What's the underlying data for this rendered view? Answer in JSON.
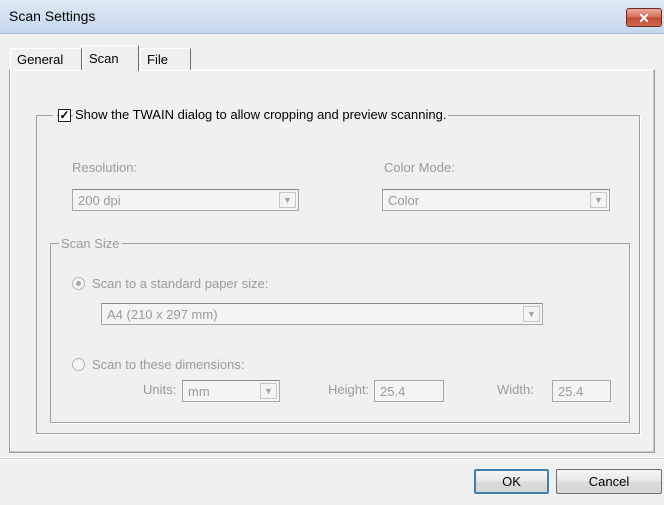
{
  "window": {
    "title": "Scan Settings",
    "close_glyph": "✕"
  },
  "tabs": [
    {
      "label": "General"
    },
    {
      "label": "Scan"
    },
    {
      "label": "File"
    }
  ],
  "twain": {
    "label": "Show the TWAIN dialog to allow cropping and preview scanning.",
    "checked": true,
    "check_glyph": "✓"
  },
  "resolution": {
    "label": "Resolution:",
    "value": "200 dpi"
  },
  "color_mode": {
    "label": "Color Mode:",
    "value": "Color"
  },
  "scan_size": {
    "legend": "Scan Size",
    "standard": {
      "label": "Scan to a standard paper size:",
      "selected": true,
      "value": "A4 (210 x 297 mm)"
    },
    "dimensions": {
      "label": "Scan to these dimensions:",
      "selected": false,
      "units_label": "Units:",
      "units_value": "mm",
      "height_label": "Height:",
      "height_value": "25.4",
      "width_label": "Width:",
      "width_value": "25.4"
    }
  },
  "arrow_glyph": "▼",
  "buttons": {
    "ok": "OK",
    "cancel": "Cancel"
  }
}
